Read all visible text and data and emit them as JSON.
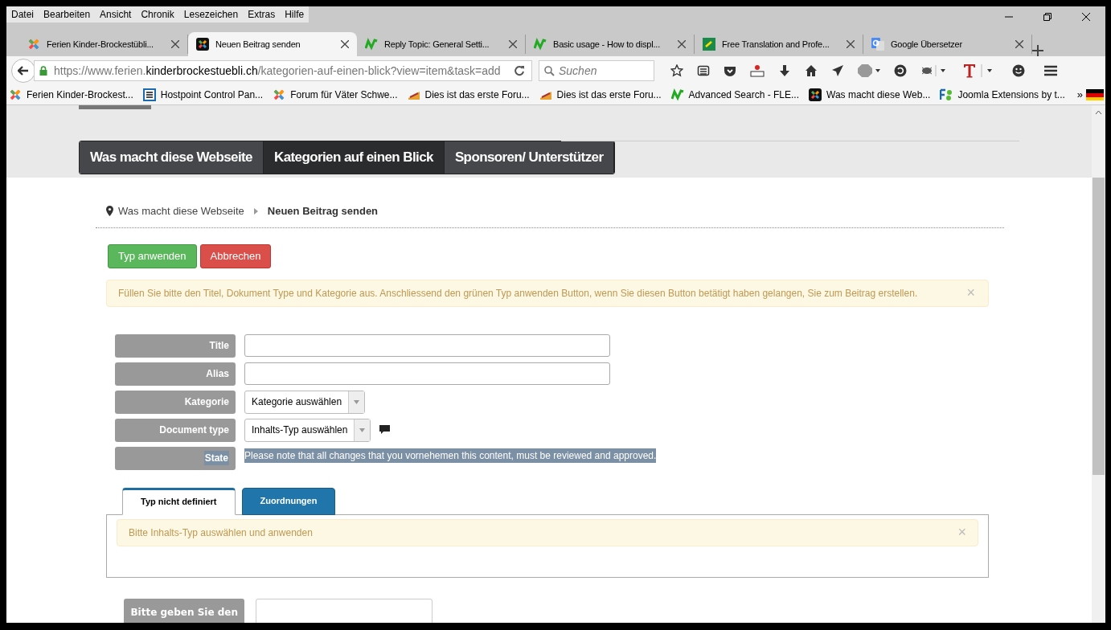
{
  "menu": [
    "Datei",
    "Bearbeiten",
    "Ansicht",
    "Chronik",
    "Lesezeichen",
    "Extras",
    "Hilfe"
  ],
  "tabs": [
    {
      "label": "Ferien Kinder-Brockestübli...",
      "kind": "joomla",
      "selected": false
    },
    {
      "label": "Neuen Beitrag senden",
      "kind": "joomla-dark",
      "selected": true
    },
    {
      "label": "Reply Topic: General Setti...",
      "kind": "nextend",
      "selected": false
    },
    {
      "label": "Basic usage - How to displ...",
      "kind": "nextend",
      "selected": false
    },
    {
      "label": "Free Translation and Profe...",
      "kind": "translate",
      "selected": false
    },
    {
      "label": "Google Übersetzer",
      "kind": "google",
      "selected": false
    }
  ],
  "url": {
    "prefix": "https://www.ferien.",
    "domain": "kinderbrockestuebli.ch",
    "path": "/kategorien-auf-einen-blick?view=item&task=add"
  },
  "search": {
    "placeholder": "Suchen"
  },
  "bookmarks": [
    {
      "label": "Ferien Kinder-Brockest...",
      "kind": "joomla"
    },
    {
      "label": "Hostpoint Control Pan...",
      "kind": "doc"
    },
    {
      "label": "Forum für Väter Schwe...",
      "kind": "joomla"
    },
    {
      "label": "Dies ist das erste Foru...",
      "kind": "forum"
    },
    {
      "label": "Dies ist das erste Foru...",
      "kind": "forum"
    },
    {
      "label": "Advanced Search - FLE...",
      "kind": "nextend"
    },
    {
      "label": "Was macht diese Web...",
      "kind": "joomla-dark"
    },
    {
      "label": "Joomla Extensions by t...",
      "kind": "fs"
    }
  ],
  "bookmarks_more": "»",
  "site_nav": [
    {
      "label": "Was macht diese Webseite",
      "selected": false
    },
    {
      "label": "Kategorien auf einen Blick",
      "selected": true
    },
    {
      "label": "Sponsoren/ Unterstützer",
      "selected": false
    }
  ],
  "breadcrumb": [
    "Was macht diese Webseite",
    "Neuen Beitrag senden"
  ],
  "actions": [
    {
      "label": "Typ anwenden",
      "kind": "success"
    },
    {
      "label": "Abbrechen",
      "kind": "danger"
    }
  ],
  "alert": {
    "text": "Füllen Sie bitte den Titel, Dokument Type und Kategorie aus. Anschliessend den grünen Typ anwenden Button, wenn Sie diesen Button betätigt haben gelangen, Sie zum Beitrag erstellen.",
    "close": "×"
  },
  "fields": [
    {
      "label": "Title",
      "kind": "text",
      "highlighted": false
    },
    {
      "label": "Alias",
      "kind": "text",
      "highlighted": false
    },
    {
      "label": "Kategorie",
      "kind": "select",
      "value": "Kategorie auswählen",
      "info": false,
      "highlighted": false
    },
    {
      "label": "Document type",
      "kind": "select",
      "value": "Inhalts-Typ auswählen",
      "info": true,
      "highlighted": false
    },
    {
      "label": "State",
      "kind": "note",
      "value": "Please note that all changes that you vornehemen this content, must be reviewed and approved.",
      "highlighted": true
    }
  ],
  "content_tabs": [
    {
      "label": "Typ nicht definiert",
      "selected": true
    },
    {
      "label": "Zuordnungen",
      "selected": false
    }
  ],
  "tab_alert": {
    "text": "Bitte Inhalts-Typ auswählen und anwenden",
    "close": "×"
  },
  "last_field": {
    "label": "Bitte geben Sie den",
    "kind": "text"
  }
}
